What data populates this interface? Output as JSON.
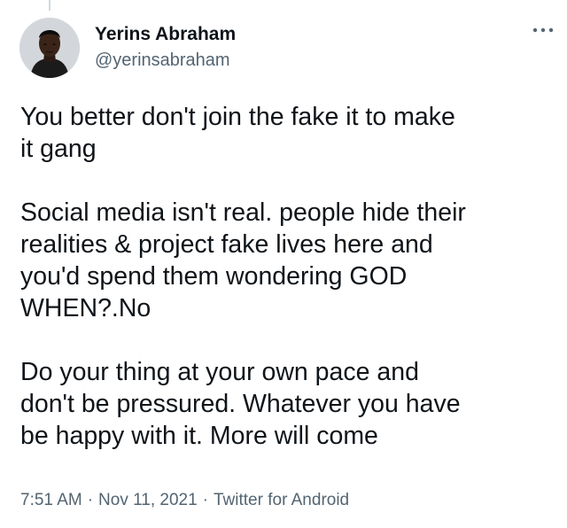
{
  "author": {
    "display_name": "Yerins Abraham",
    "handle": "@yerinsabraham",
    "avatar_icon": "profile-photo-avatar"
  },
  "menu": {
    "more_icon": "more-horizontal-icon"
  },
  "tweet": {
    "paragraph1": [
      "You better don't join the fake it to make",
      "it gang"
    ],
    "paragraph2": [
      "Social media isn't real. people hide their",
      "realities & project fake lives here and",
      "you'd spend them wondering GOD",
      "WHEN?.No"
    ],
    "paragraph3": [
      "Do your thing at your own pace and",
      "don't be pressured. Whatever you have",
      "be happy with it. More will come"
    ]
  },
  "meta": {
    "time": "7:51 AM",
    "separator": "·",
    "date": "Nov 11, 2021",
    "source": "Twitter for Android"
  },
  "colors": {
    "text_primary": "#0f1419",
    "text_secondary": "#536471",
    "thread_line": "#cfd9de"
  }
}
